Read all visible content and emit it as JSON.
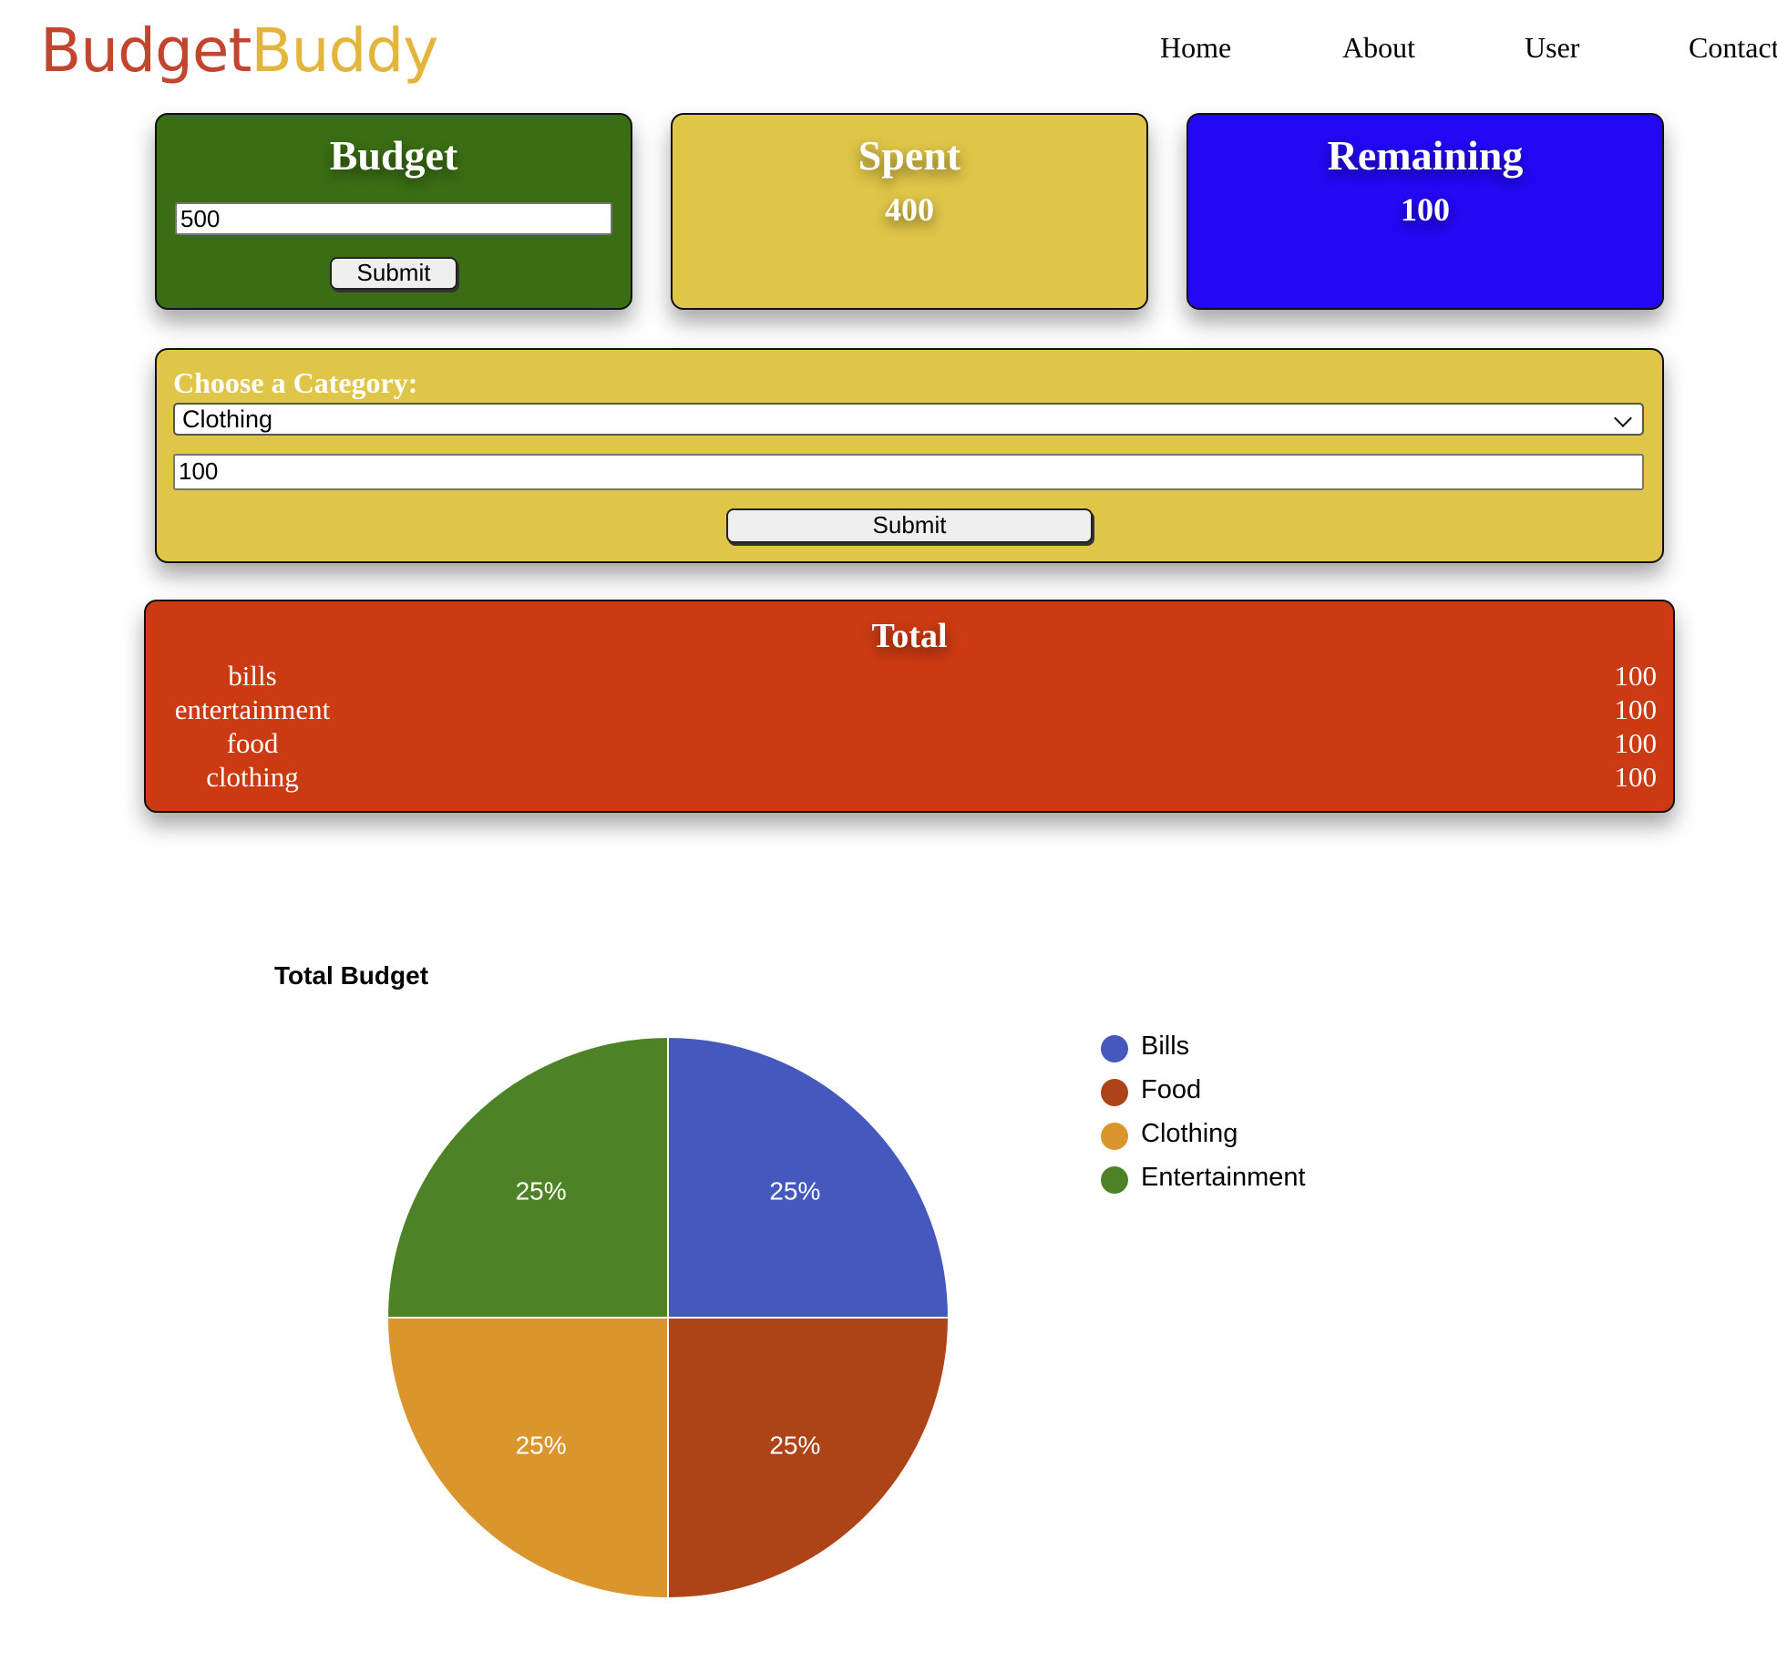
{
  "logo": {
    "part1": "Budget",
    "part2": "Buddy"
  },
  "nav": [
    "Home",
    "About",
    "User",
    "Contact"
  ],
  "budget_card": {
    "title": "Budget",
    "input_value": "500",
    "submit_label": "Submit",
    "color": "#3b6e14"
  },
  "spent_card": {
    "title": "Spent",
    "value": "400",
    "color": "#dfc548"
  },
  "remaining_card": {
    "title": "Remaining",
    "value": "100",
    "color": "#2308f3"
  },
  "category_form": {
    "label": "Choose a Category:",
    "selected": "Clothing",
    "amount": "100",
    "submit_label": "Submit",
    "color": "#dfc548"
  },
  "total": {
    "title": "Total",
    "color": "#cb3a13",
    "rows": [
      {
        "name": "bills",
        "value": "100"
      },
      {
        "name": "entertainment",
        "value": "100"
      },
      {
        "name": "food",
        "value": "100"
      },
      {
        "name": "clothing",
        "value": "100"
      }
    ]
  },
  "chart_data": {
    "type": "pie",
    "title": "Total Budget",
    "legend_position": "right",
    "slices": [
      {
        "label": "Bills",
        "value": 100,
        "percent_label": "25%",
        "color": "#4558bd"
      },
      {
        "label": "Food",
        "value": 100,
        "percent_label": "25%",
        "color": "#ad4418"
      },
      {
        "label": "Clothing",
        "value": 100,
        "percent_label": "25%",
        "color": "#da952c"
      },
      {
        "label": "Entertainment",
        "value": 100,
        "percent_label": "25%",
        "color": "#4d8326"
      }
    ]
  }
}
